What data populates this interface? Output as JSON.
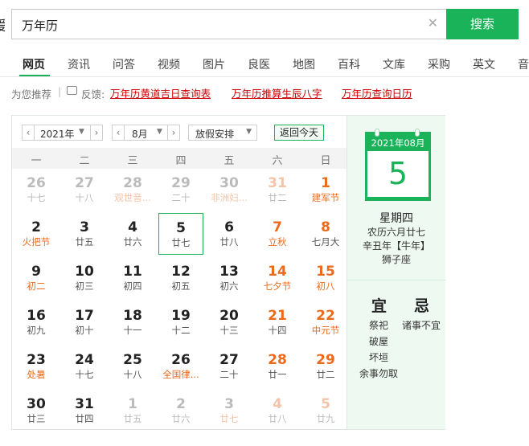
{
  "search": {
    "logo_fragment": "爱",
    "query": "万年历",
    "clear_icon": "close-icon",
    "button_label": "搜索"
  },
  "nav": {
    "tabs": [
      "网页",
      "资讯",
      "问答",
      "视频",
      "图片",
      "良医",
      "地图",
      "百科",
      "文库",
      "采购",
      "英文",
      "音"
    ],
    "active": "网页"
  },
  "recommend": {
    "label": "为您推荐",
    "feedback": "反馈:",
    "links": [
      "万年历黄道吉日查询表",
      "万年历推算生辰八字",
      "万年历查询日历"
    ]
  },
  "calendar": {
    "year": "2021年",
    "month": "8月",
    "holiday_select": "放假安排",
    "today_button": "返回今天",
    "weekdays": [
      "一",
      "二",
      "三",
      "四",
      "五",
      "六",
      "日"
    ],
    "weeks": [
      [
        {
          "d": "26",
          "l": "十七",
          "o": true
        },
        {
          "d": "27",
          "l": "十八",
          "o": true
        },
        {
          "d": "28",
          "l": "观世音...",
          "o": true,
          "hl": true
        },
        {
          "d": "29",
          "l": "二十",
          "o": true
        },
        {
          "d": "30",
          "l": "非洲妇...",
          "o": true,
          "hl": true
        },
        {
          "d": "31",
          "l": "廿二",
          "o": true,
          "r": true
        },
        {
          "d": "1",
          "l": "建军节",
          "r": true,
          "hl": true
        }
      ],
      [
        {
          "d": "2",
          "l": "火把节",
          "hl": true
        },
        {
          "d": "3",
          "l": "廿五"
        },
        {
          "d": "4",
          "l": "廿六"
        },
        {
          "d": "5",
          "l": "廿七",
          "s": true
        },
        {
          "d": "6",
          "l": "廿八"
        },
        {
          "d": "7",
          "l": "立秋",
          "r": true,
          "hl": true
        },
        {
          "d": "8",
          "l": "七月大",
          "r": true
        }
      ],
      [
        {
          "d": "9",
          "l": "初二",
          "hl": true
        },
        {
          "d": "10",
          "l": "初三"
        },
        {
          "d": "11",
          "l": "初四"
        },
        {
          "d": "12",
          "l": "初五"
        },
        {
          "d": "13",
          "l": "初六"
        },
        {
          "d": "14",
          "l": "七夕节",
          "r": true,
          "hl": true
        },
        {
          "d": "15",
          "l": "初八",
          "r": true,
          "hl": true
        }
      ],
      [
        {
          "d": "16",
          "l": "初九"
        },
        {
          "d": "17",
          "l": "初十"
        },
        {
          "d": "18",
          "l": "十一"
        },
        {
          "d": "19",
          "l": "十二"
        },
        {
          "d": "20",
          "l": "十三"
        },
        {
          "d": "21",
          "l": "十四",
          "r": true
        },
        {
          "d": "22",
          "l": "中元节",
          "r": true,
          "hl": true
        }
      ],
      [
        {
          "d": "23",
          "l": "处暑",
          "hl": true
        },
        {
          "d": "24",
          "l": "十七"
        },
        {
          "d": "25",
          "l": "十八"
        },
        {
          "d": "26",
          "l": "全国律...",
          "hl": true
        },
        {
          "d": "27",
          "l": "二十"
        },
        {
          "d": "28",
          "l": "廿一",
          "r": true
        },
        {
          "d": "29",
          "l": "廿二",
          "r": true
        }
      ],
      [
        {
          "d": "30",
          "l": "廿三"
        },
        {
          "d": "31",
          "l": "廿四"
        },
        {
          "d": "1",
          "l": "廿五",
          "o": true
        },
        {
          "d": "2",
          "l": "廿六",
          "o": true
        },
        {
          "d": "3",
          "l": "廿七",
          "o": true,
          "hl": true
        },
        {
          "d": "4",
          "l": "廿八",
          "o": true,
          "r": true
        },
        {
          "d": "5",
          "l": "廿九",
          "o": true,
          "r": true
        }
      ]
    ]
  },
  "detail": {
    "year_month": "2021年08月",
    "day": "5",
    "weekday": "星期四",
    "lunar": "农历六月廿七",
    "ganzhi": "辛丑年【牛年】",
    "zodiac": "狮子座",
    "yi_title": "宜",
    "ji_title": "忌",
    "yi_items": [
      "祭祀",
      "破屋",
      "坏垣",
      "余事勿取"
    ],
    "ji_items": [
      "诸事不宜"
    ]
  },
  "colors": {
    "accent": "#1bb35a",
    "weekend": "#ec6a1c",
    "link": "#cc0000"
  }
}
